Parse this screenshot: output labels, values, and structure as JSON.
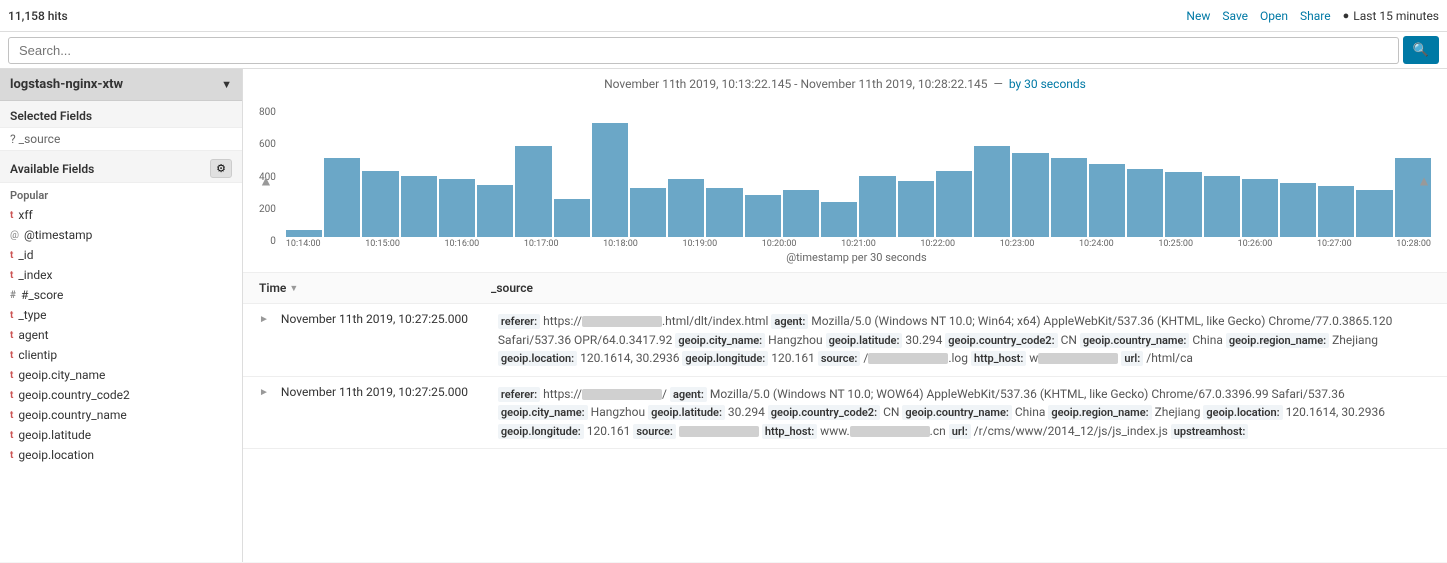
{
  "topbar": {
    "hits": "11,158 hits",
    "new_label": "New",
    "save_label": "Save",
    "open_label": "Open",
    "share_label": "Share",
    "time_range": "Last 15 minutes"
  },
  "search": {
    "placeholder": "Search...",
    "search_button_label": "🔍"
  },
  "sidebar": {
    "index_name": "logstash-nginx-xtw",
    "selected_fields_label": "Selected Fields",
    "source_field": "? _source",
    "available_fields_label": "Available Fields",
    "popular_label": "Popular",
    "fields": [
      {
        "name": "xff",
        "type": "t"
      },
      {
        "name": "@timestamp",
        "type": "@"
      },
      {
        "name": "_id",
        "type": "t"
      },
      {
        "name": "_index",
        "type": "t"
      },
      {
        "name": "#_score",
        "type": "#"
      },
      {
        "name": "_type",
        "type": "t"
      },
      {
        "name": "agent",
        "type": "t"
      },
      {
        "name": "clientip",
        "type": "t"
      },
      {
        "name": "geoip.city_name",
        "type": "t"
      },
      {
        "name": "geoip.country_code2",
        "type": "t"
      },
      {
        "name": "geoip.country_name",
        "type": "t"
      },
      {
        "name": "geoip.latitude",
        "type": "t"
      },
      {
        "name": "geoip.location",
        "type": "t"
      }
    ]
  },
  "chart": {
    "title": "November 11th 2019, 10:13:22.145 - November 11th 2019, 10:28:22.145",
    "interval_label": "by 30 seconds",
    "x_axis_label": "@timestamp per 30 seconds",
    "y_labels": [
      "800",
      "600",
      "400",
      "200",
      "0"
    ],
    "x_labels": [
      "10:14:00",
      "10:15:00",
      "10:16:00",
      "10:17:00",
      "10:18:00",
      "10:19:00",
      "10:20:00",
      "10:21:00",
      "10:22:00",
      "10:23:00",
      "10:24:00",
      "10:25:00",
      "10:26:00",
      "10:27:00",
      "10:28:00"
    ],
    "bars": [
      40,
      450,
      380,
      350,
      330,
      300,
      520,
      220,
      650,
      280,
      330,
      280,
      240,
      270,
      200,
      350,
      320,
      380,
      520,
      480,
      450,
      420,
      390,
      370,
      350,
      330,
      310,
      290,
      270,
      450
    ]
  },
  "results": {
    "col_time": "Time",
    "col_source": "_source",
    "rows": [
      {
        "time": "November 11th 2019, 10:27:25.000",
        "source_text": "referer: https://[REDACTED].html/dlt/index.html agent: Mozilla/5.0 (Windows NT 10.0; Win64; x64) AppleWebKit/537.36 (KHTML, like Gecko) Chrome/77.0.3865.120 Safari/537.36 OPR/64.0.3417.92 geoip.city_name: Hangzhou geoip.latitude: 30.294 geoip.country_code2: CN geoip.country_name: China geoip.region_name: Zhejiang geoip.location: 120.1614, 30.2936 geoip.longitude: 120.161 source: /[REDACTED].log http_host: w[REDACTED] url: /html/ca"
      },
      {
        "time": "November 11th 2019, 10:27:25.000",
        "source_text": "referer: https://[REDACTED]/ agent: Mozilla/5.0 (Windows NT 10.0; WOW64) AppleWebKit/537.36 (KHTML, like Gecko) Chrome/67.0.3396.99 Safari/537.36 geoip.city_name: Hangzhou geoip.latitude: 30.294 geoip.country_code2: CN geoip.country_name: China geoip.region_name: Zhejiang geoip.location: 120.1614, 30.2936 geoip.longitude: 120.161 source: [REDACTED] http_host: www.[REDACTED].cn url: /r/cms/www/2014_12/js/js_index.js upstreamhost:"
      }
    ]
  }
}
